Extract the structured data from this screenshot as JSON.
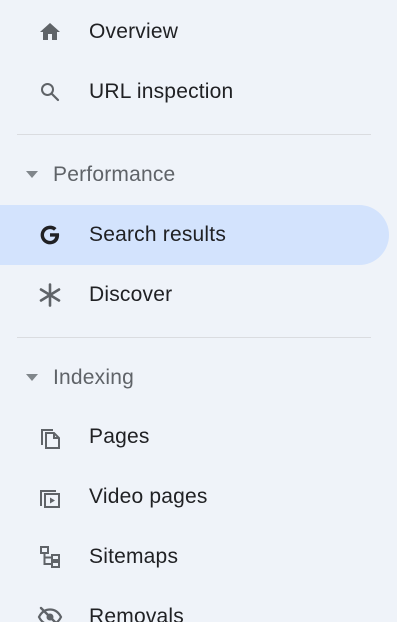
{
  "nav": {
    "top_items": [
      {
        "label": "Overview",
        "icon": "home-icon"
      },
      {
        "label": "URL inspection",
        "icon": "search-icon"
      }
    ],
    "performance": {
      "heading": "Performance",
      "items": [
        {
          "label": "Search results",
          "icon": "google-g-icon",
          "active": true
        },
        {
          "label": "Discover",
          "icon": "asterisk-icon"
        }
      ]
    },
    "indexing": {
      "heading": "Indexing",
      "items": [
        {
          "label": "Pages",
          "icon": "pages-icon"
        },
        {
          "label": "Video pages",
          "icon": "video-pages-icon"
        },
        {
          "label": "Sitemaps",
          "icon": "sitemap-icon"
        },
        {
          "label": "Removals",
          "icon": "eye-off-icon"
        }
      ]
    }
  },
  "colors": {
    "background": "#eff3f9",
    "active_background": "#d3e3fd",
    "text": "#202124",
    "muted": "#5f6368",
    "icon": "#5f6368",
    "divider": "#dadce0"
  }
}
